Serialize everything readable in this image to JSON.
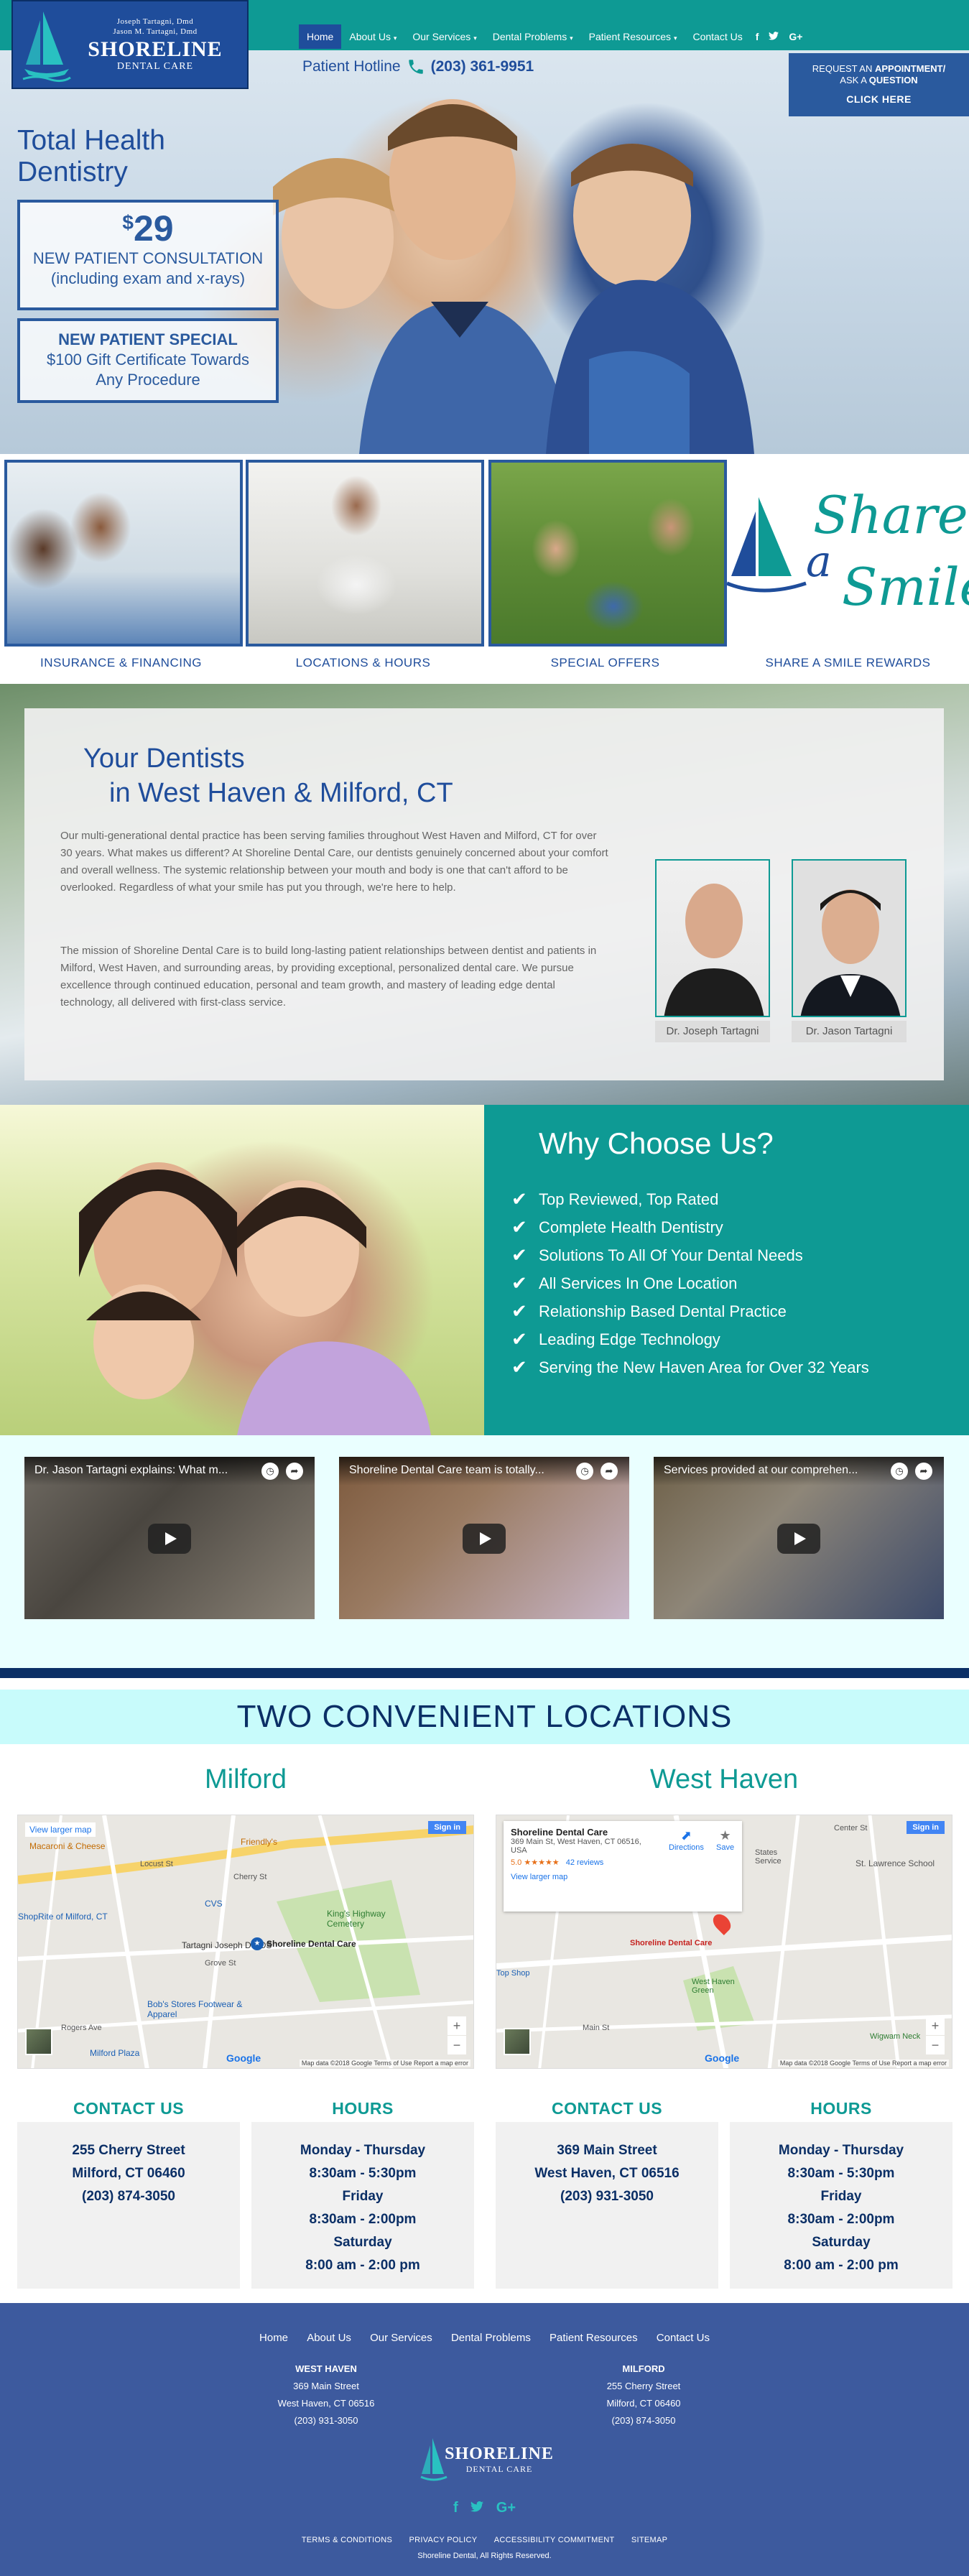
{
  "header": {
    "logo": {
      "line1": "Joseph Tartagni, dmd",
      "line2": "Jason M. Tartagni, dmd",
      "brand": "SHORELINE",
      "sub": "DENTAL CARE"
    },
    "nav": [
      "Home",
      "About Us",
      "Our Services",
      "Dental Problems",
      "Patient Resources",
      "Contact Us"
    ],
    "nav_dropdowns": [
      "About Us",
      "Our Services",
      "Dental Problems",
      "Patient Resources"
    ],
    "social": [
      "f",
      "t",
      "G+"
    ],
    "hotline_label": "Patient Hotline",
    "hotline_number": "(203) 361-9951",
    "request": {
      "line1a": "REQUEST AN",
      "line1b": "APPOINTMENT/",
      "line2a": "ASK A",
      "line2b": "QUESTION",
      "click": "CLICK HERE"
    }
  },
  "hero": {
    "tagline1": "Total Health",
    "tagline2": "Dentistry",
    "offer1": {
      "currency": "$",
      "price": "29",
      "line1": "NEW PATIENT CONSULTATION",
      "line2": "(including exam and x-rays)"
    },
    "offer2": {
      "title": "NEW PATIENT SPECIAL",
      "line1": "$100 Gift Certificate Towards",
      "line2": "Any Procedure"
    }
  },
  "promos": [
    {
      "label": "INSURANCE & FINANCING"
    },
    {
      "label": "LOCATIONS & HOURS"
    },
    {
      "label": "SPECIAL OFFERS"
    },
    {
      "label": "SHARE A SMILE REWARDS"
    }
  ],
  "share_smile": {
    "w1": "Share",
    "w2": "a",
    "w3": "Smile"
  },
  "dentists": {
    "title1": "Your Dentists",
    "title2": "in West Haven & Milford, CT",
    "para1": "Our multi-generational dental practice has been serving families throughout West Haven and Milford, CT for over 30 years. What makes us different? At Shoreline Dental Care, our dentists genuinely concerned about your comfort and overall wellness. The systemic relationship between your mouth and body is one that can't afford to be overlooked. Regardless of what your smile has put you through, we're here to help.",
    "para2": "The mission of Shoreline Dental Care is to build long-lasting patient relationships between dentist and patients in Milford, West Haven, and surrounding areas, by providing exceptional, personalized dental care. We pursue excellence through continued education, personal and team growth, and mastery of leading edge dental technology, all delivered with first-class service.",
    "doctors": [
      "Dr. Joseph Tartagni",
      "Dr. Jason Tartagni"
    ]
  },
  "why": {
    "title": "Why Choose Us?",
    "items": [
      "Top Reviewed, Top Rated",
      "Complete Health Dentistry",
      "Solutions To All Of Your Dental Needs",
      "All Services In One Location",
      "Relationship Based Dental Practice",
      "Leading Edge Technology",
      "Serving the New Haven Area for Over 32 Years"
    ]
  },
  "videos": [
    {
      "title": "Dr. Jason Tartagni explains: What m..."
    },
    {
      "title": "Shoreline Dental Care team is totally..."
    },
    {
      "title": "Services provided at our comprehen..."
    }
  ],
  "locations": {
    "title": "TWO CONVENIENT LOCATIONS",
    "cities": [
      "Milford",
      "West Haven"
    ],
    "map_milford": {
      "larger": "View larger map",
      "signin": "Sign in",
      "place": "Tartagni Joseph D DDS",
      "place2": "Shoreline Dental Care",
      "labels": [
        "Macaroni & Cheese",
        "Friendly's",
        "ShopRite of Milford, CT",
        "CVS",
        "King's Highway Cemetery",
        "Bob's Stores Footwear & Apparel",
        "Milford Plaza",
        "Cherry St",
        "Locust St",
        "Grove St",
        "Rogers Ave"
      ],
      "google": "Google",
      "footer": "Map data ©2018 Google   Terms of Use   Report a map error"
    },
    "map_westhaven": {
      "card_title": "Shoreline Dental Care",
      "card_addr1": "369 Main St, West Haven, CT 06516,",
      "card_addr2": "USA",
      "rating": "5.0",
      "stars": "★★★★★",
      "reviews": "42 reviews",
      "larger": "View larger map",
      "directions": "Directions",
      "save": "Save",
      "signin": "Sign in",
      "pin_label": "Shoreline Dental Care",
      "labels": [
        "States Service",
        "St. Lawrence School",
        "West Haven Green",
        "Wigwam Neck",
        "Top Shop",
        "Main St",
        "Center St"
      ],
      "google": "Google",
      "footer": "Map data ©2018 Google   Terms of Use   Report a map error"
    },
    "contact_title": "CONTACT US",
    "hours_title": "HOURS",
    "milford": {
      "street": "255 Cherry Street",
      "city": "Milford, CT 06460",
      "phone": "(203) 874-3050"
    },
    "westhaven": {
      "street": "369 Main Street",
      "city": "West Haven, CT 06516",
      "phone": "(203) 931-3050"
    },
    "hours": [
      "Monday - Thursday",
      "8:30am - 5:30pm",
      "Friday",
      "8:30am - 2:00pm",
      "Saturday",
      "8:00 am - 2:00 pm"
    ]
  },
  "footer": {
    "nav": [
      "Home",
      "About Us",
      "Our Services",
      "Dental Problems",
      "Patient Resources",
      "Contact Us"
    ],
    "wh": {
      "title": "WEST HAVEN",
      "l1": "369 Main Street",
      "l2": "West Haven, CT 06516",
      "l3": "(203) 931-3050"
    },
    "mf": {
      "title": "MILFORD",
      "l1": "255 Cherry Street",
      "l2": "Milford, CT 06460",
      "l3": "(203) 874-3050"
    },
    "brand": "SHORELINE",
    "sub": "DENTAL CARE",
    "social": [
      "f",
      "t",
      "G+"
    ],
    "links": [
      "TERMS & CONDITIONS",
      "PRIVACY POLICY",
      "ACCESSIBILITY COMMITMENT",
      "SITEMAP"
    ],
    "copyright": "Shoreline Dental, All Rights Reserved."
  },
  "colors": {
    "teal": "#0e9a94",
    "navy": "#1f4d9b",
    "dark_navy": "#0b2f66",
    "footer": "#3d5a9e",
    "light_cyan": "#c8fbfb"
  }
}
